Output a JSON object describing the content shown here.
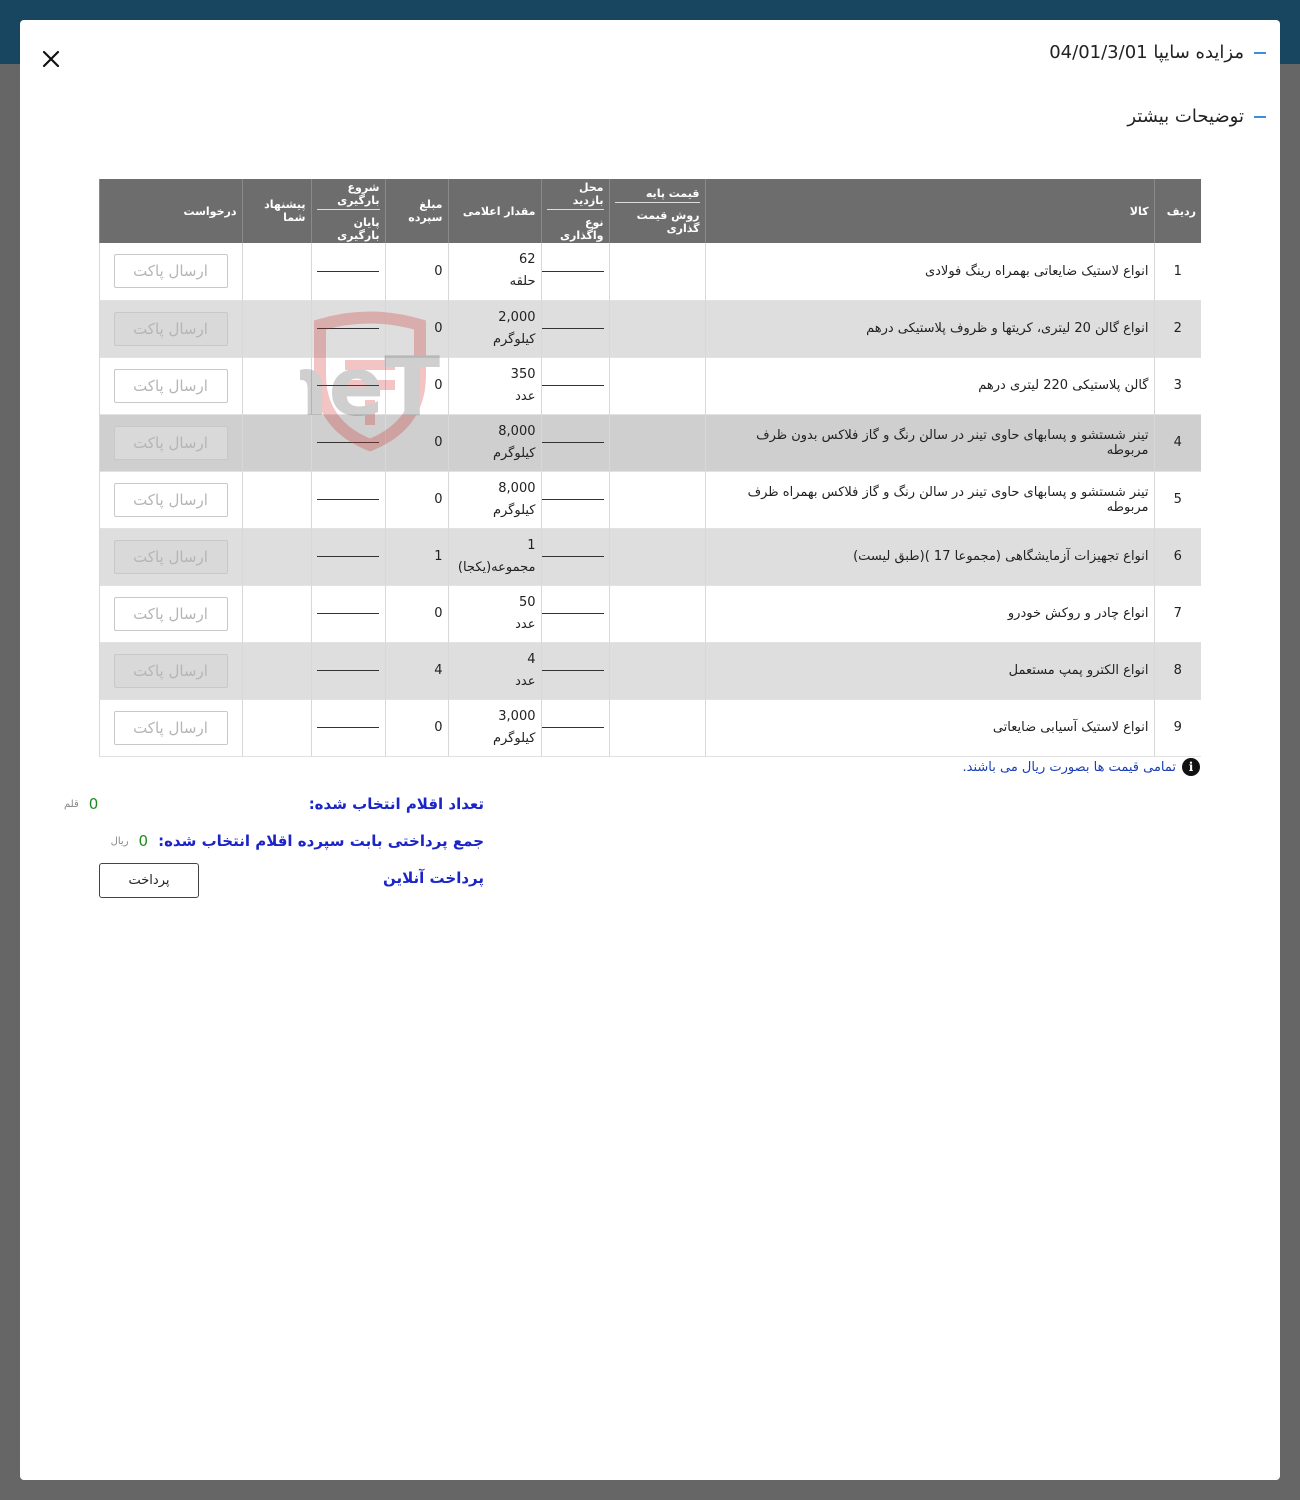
{
  "header": {
    "title": "مزایده سایپا 04/01/3/01",
    "more_info": "توضیحات بیشتر"
  },
  "table": {
    "columns": {
      "row": "ردیف",
      "item": "کالا",
      "base_price": "قیمت پایه",
      "pricing_method": "روش قیمت گذاری",
      "visit_place": "محل بازدید",
      "assignment_type": "نوع واگذاری",
      "quantity": "مقدار اعلامی",
      "deposit": "مبلغ سپرده",
      "load_start": "شروع بارگیری",
      "load_end": "پایان بارگیری",
      "your_offer": "پیشنهاد شما",
      "request": "درخواست"
    },
    "rows": [
      {
        "num": "1",
        "item": "انواع لاستیک ضایعاتی بهمراه رینگ فولادی",
        "qty": "62",
        "unit": "حلقه",
        "deposit": "0",
        "action": "ارسال پاکت"
      },
      {
        "num": "2",
        "item": "انواع گالن 20 لیتری، کریتها و ظروف پلاستیکی درهم",
        "qty": "2,000",
        "unit": "کیلوگرم",
        "deposit": "0",
        "action": "ارسال پاکت"
      },
      {
        "num": "3",
        "item": "گالن پلاستیکی 220 لیتری درهم",
        "qty": "350",
        "unit": "عدد",
        "deposit": "0",
        "action": "ارسال پاکت"
      },
      {
        "num": "4",
        "item": "تینر شستشو و پسابهای حاوی تینر در سالن رنگ و گاز فلاکس بدون ظرف مربوطه",
        "qty": "8,000",
        "unit": "کیلوگرم",
        "deposit": "0",
        "action": "ارسال پاکت"
      },
      {
        "num": "5",
        "item": "تینر شستشو و پسابهای حاوی تینر در سالن رنگ و گاز فلاکس بهمراه ظرف مربوطه",
        "qty": "8,000",
        "unit": "کیلوگرم",
        "deposit": "0",
        "action": "ارسال پاکت"
      },
      {
        "num": "6",
        "item": "انواع تجهیزات آزمایشگاهی (مجموعا 17 )(طبق لیست)",
        "qty": "1",
        "unit": "مجموعه(یکجا)",
        "deposit": "1",
        "action": "ارسال پاکت"
      },
      {
        "num": "7",
        "item": "انواع چادر و روکش خودرو",
        "qty": "50",
        "unit": "عدد",
        "deposit": "0",
        "action": "ارسال پاکت"
      },
      {
        "num": "8",
        "item": "انواع الکترو پمپ مستعمل",
        "qty": "4",
        "unit": "عدد",
        "deposit": "4",
        "action": "ارسال پاکت"
      },
      {
        "num": "9",
        "item": "انواع لاستیک آسیابی ضایعاتی",
        "qty": "3,000",
        "unit": "کیلوگرم",
        "deposit": "0",
        "action": "ارسال پاکت"
      }
    ]
  },
  "watermark_text": "AriaTender.neT",
  "note": "تمامی قیمت ها بصورت ریال می باشند.",
  "summary": {
    "selected_count_label": "تعداد اقلام انتخاب شده:",
    "selected_count_value": "0",
    "selected_count_unit": "قلم",
    "deposit_total_label": "جمع پرداختی بابت سپرده اقلام انتخاب شده:",
    "deposit_total_value": "0",
    "deposit_total_unit": "ریال",
    "online_payment_label": "پرداخت آنلاین",
    "pay_button": "پرداخت"
  },
  "colors": {
    "topbar": "#184560",
    "table_header": "#6d6d6d",
    "accent_dash": "#3a8fd8",
    "summary_label": "#1a24c9",
    "summary_value": "#1f8a1f"
  }
}
